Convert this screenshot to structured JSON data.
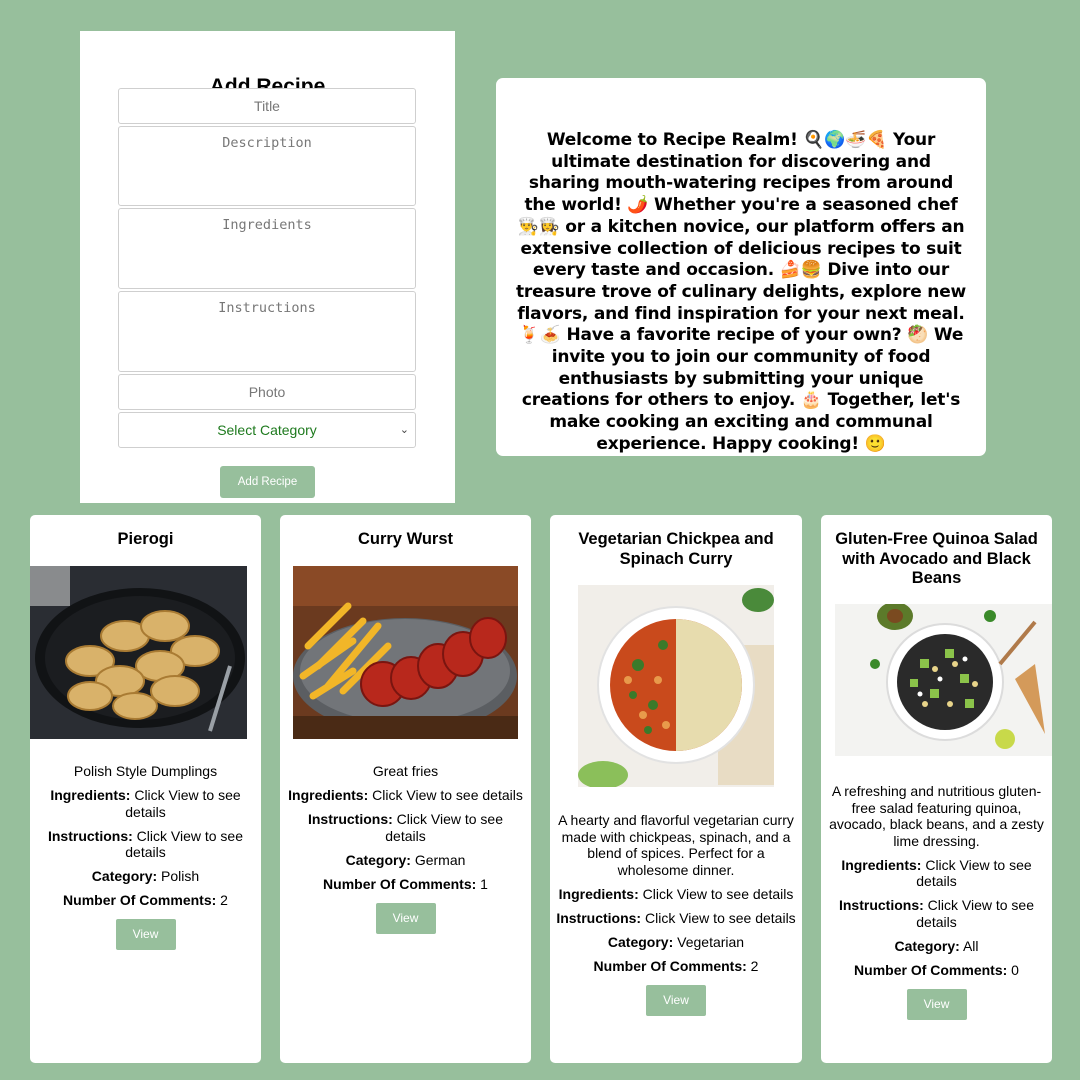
{
  "form": {
    "title": "Add Recipe",
    "title_placeholder": "Title",
    "description_placeholder": "Description",
    "ingredients_placeholder": "Ingredients",
    "instructions_placeholder": "Instructions",
    "photo_placeholder": "Photo",
    "category_selected": "Select Category",
    "submit_label": "Add Recipe"
  },
  "welcome": {
    "text": "Welcome to Recipe Realm! 🍳🌍🍜🍕 Your ultimate destination for discovering and sharing mouth-watering recipes from around the world! 🌶️ Whether you're a seasoned chef 👨‍🍳👩‍🍳 or a kitchen novice, our platform offers an extensive collection of delicious recipes to suit every taste and occasion. 🍰🍔 Dive into our treasure trove of culinary delights, explore new flavors, and find inspiration for your next meal. 🍹🍝 Have a favorite recipe of your own? 🥙 We invite you to join our community of food enthusiasts by submitting your unique creations for others to enjoy. 🎂 Together, let's make cooking an exciting and communal experience. Happy cooking! 🙂"
  },
  "labels": {
    "ingredients": "Ingredients:",
    "instructions": "Instructions:",
    "category": "Category:",
    "comments": "Number Of Comments:",
    "view": "View"
  },
  "recipes": [
    {
      "title": "Pierogi",
      "description": "Polish Style Dumplings",
      "ingredients": "Click View to see details",
      "instructions": "Click View to see details",
      "category": "Polish",
      "comments": "2",
      "image": "pierogi-dish-image"
    },
    {
      "title": "Curry Wurst",
      "description": "Great fries",
      "ingredients": "Click View to see details",
      "instructions": "Click View to see details",
      "category": "German",
      "comments": "1",
      "image": "currywurst-fries-image"
    },
    {
      "title": "Vegetarian Chickpea and Spinach Curry",
      "description": "A hearty and flavorful vegetarian curry made with chickpeas, spinach, and a blend of spices. Perfect for a wholesome dinner.",
      "ingredients": "Click View to see details",
      "instructions": "Click View to see details",
      "category": "Vegetarian",
      "comments": "2",
      "image": "chickpea-curry-bowl-image"
    },
    {
      "title": "Gluten-Free Quinoa Salad with Avocado and Black Beans",
      "description": "A refreshing and nutritious gluten-free salad featuring quinoa, avocado, black beans, and a zesty lime dressing.",
      "ingredients": "Click View to see details",
      "instructions": "Click View to see details",
      "category": "All",
      "comments": "0",
      "image": "quinoa-salad-bowl-image"
    }
  ],
  "colors": {
    "background": "#97bf9c",
    "button": "#97bf9c",
    "select_text": "#1e7a1e"
  }
}
